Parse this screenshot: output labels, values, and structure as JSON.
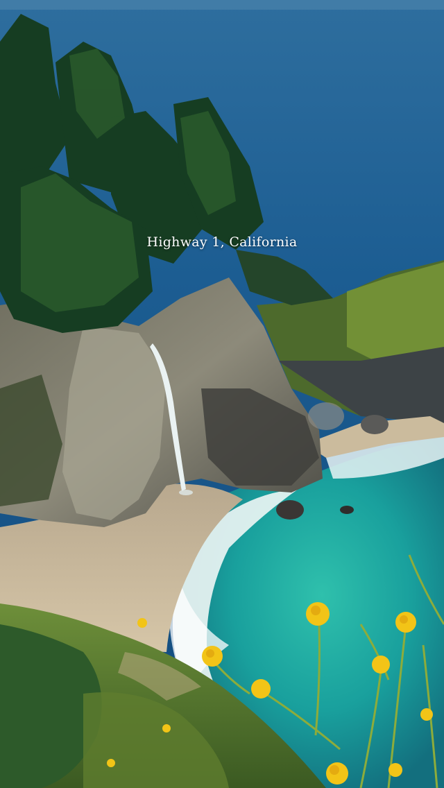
{
  "caption": "Highway 1, California",
  "scene": {
    "content": [
      "ocean",
      "cliff",
      "waterfall",
      "beach",
      "cypress-trees",
      "yellow-wildflowers"
    ],
    "colors": {
      "ocean_deep": "#1b5d93",
      "ocean_teal": "#1fa3a0",
      "sand": "#c9b89d",
      "foliage": "#1f4d2a",
      "flowers": "#f2c417"
    }
  }
}
